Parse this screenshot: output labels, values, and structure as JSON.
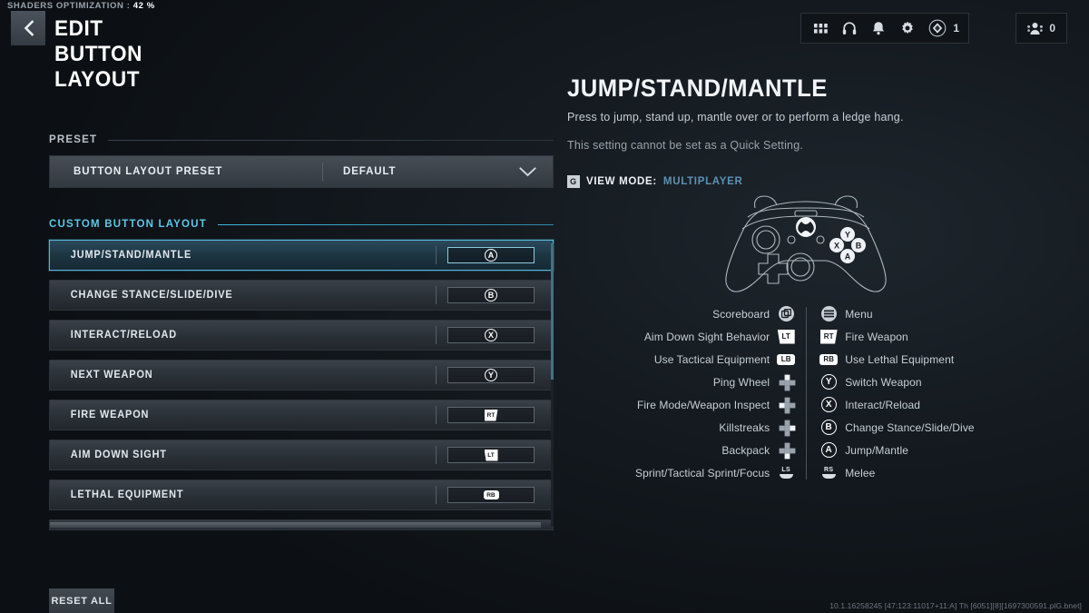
{
  "status": {
    "shaders_label": "SHADERS OPTIMIZATION :",
    "shaders_percent": "42 %"
  },
  "header": {
    "title": "EDIT BUTTON LAYOUT",
    "back_icon": "chevron-left-icon"
  },
  "topbar": {
    "icons": [
      {
        "name": "apps-grid-icon"
      },
      {
        "name": "headphones-icon"
      },
      {
        "name": "bell-icon"
      },
      {
        "name": "gear-icon"
      }
    ],
    "currency_badge": {
      "icon": "diamond-icon",
      "count": "1"
    },
    "party_badge": {
      "icon": "party-icon",
      "count": "0"
    }
  },
  "settings": {
    "preset_section": {
      "title": "PRESET"
    },
    "preset_row": {
      "label": "BUTTON LAYOUT PRESET",
      "value": "DEFAULT",
      "chevron": "chevron-down-icon"
    },
    "custom_section": {
      "title": "CUSTOM BUTTON LAYOUT"
    },
    "rows": [
      {
        "label": "JUMP/STAND/MANTLE",
        "binding": "A",
        "glyph": "circle",
        "selected": true
      },
      {
        "label": "CHANGE STANCE/SLIDE/DIVE",
        "binding": "B",
        "glyph": "circle",
        "selected": false
      },
      {
        "label": "INTERACT/RELOAD",
        "binding": "X",
        "glyph": "circle",
        "selected": false
      },
      {
        "label": "NEXT WEAPON",
        "binding": "Y",
        "glyph": "circle",
        "selected": false
      },
      {
        "label": "FIRE WEAPON",
        "binding": "RT",
        "glyph": "trigger",
        "selected": false
      },
      {
        "label": "AIM DOWN SIGHT",
        "binding": "LT",
        "glyph": "trigger-left",
        "selected": false
      },
      {
        "label": "LETHAL EQUIPMENT",
        "binding": "RB",
        "glyph": "bumper",
        "selected": false
      }
    ]
  },
  "detail": {
    "title": "JUMP/STAND/MANTLE",
    "description": "Press to jump, stand up, mantle over or to perform a ledge hang.",
    "note": "This setting cannot be set as a Quick Setting.",
    "view_mode": {
      "key": "G",
      "label": "VIEW MODE:",
      "value": "MULTIPLAYER"
    },
    "controller_icon": "xbox-controller-icon"
  },
  "legend": {
    "left": [
      {
        "label": "Scoreboard",
        "glyph": "view-button",
        "glyph_text": ""
      },
      {
        "label": "Aim Down Sight Behavior",
        "glyph": "trigger-left",
        "glyph_text": "LT"
      },
      {
        "label": "Use Tactical Equipment",
        "glyph": "bumper",
        "glyph_text": "LB"
      },
      {
        "label": "Ping Wheel",
        "glyph": "dpad-up",
        "glyph_text": ""
      },
      {
        "label": "Fire Mode/Weapon Inspect",
        "glyph": "dpad-left",
        "glyph_text": ""
      },
      {
        "label": "Killstreaks",
        "glyph": "dpad-right",
        "glyph_text": ""
      },
      {
        "label": "Backpack",
        "glyph": "dpad-down",
        "glyph_text": ""
      },
      {
        "label": "Sprint/Tactical Sprint/Focus",
        "glyph": "stick",
        "glyph_text": "LS"
      }
    ],
    "right": [
      {
        "label": "Menu",
        "glyph": "menu-button",
        "glyph_text": ""
      },
      {
        "label": "Fire Weapon",
        "glyph": "trigger",
        "glyph_text": "RT"
      },
      {
        "label": "Use Lethal Equipment",
        "glyph": "bumper",
        "glyph_text": "RB"
      },
      {
        "label": "Switch Weapon",
        "glyph": "circle",
        "glyph_text": "Y"
      },
      {
        "label": "Interact/Reload",
        "glyph": "circle",
        "glyph_text": "X"
      },
      {
        "label": "Change Stance/Slide/Dive",
        "glyph": "circle",
        "glyph_text": "B"
      },
      {
        "label": "Jump/Mantle",
        "glyph": "circle",
        "glyph_text": "A"
      },
      {
        "label": "Melee",
        "glyph": "stick",
        "glyph_text": "RS"
      }
    ]
  },
  "footer": {
    "reset_label": "RESET ALL",
    "build_string": "10.1.16258245 [47:123:11017+11:A] Th [6051][8][1697300591.plG.bnet]"
  },
  "colors": {
    "accent_cyan": "#59c8e8",
    "selection_border": "#56b6d6",
    "view_mode_value": "#5b93b3",
    "background": "#0d1014"
  }
}
